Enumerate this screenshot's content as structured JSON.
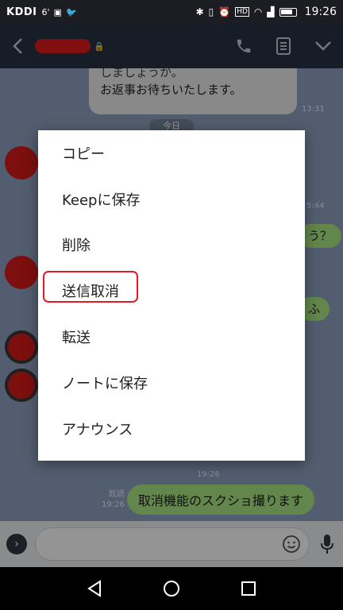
{
  "status_bar": {
    "carrier": "KDDI",
    "time": "19:26",
    "hd": "HD"
  },
  "header": {
    "back_icon": "chevron-left-icon",
    "icons": [
      "phone-icon",
      "notes-icon",
      "chevron-down-icon"
    ]
  },
  "chat": {
    "gray_bubble_lines": [
      "しましょうか。",
      "お返事お待ちいたします。"
    ],
    "gray_bubble_time": "13:31",
    "date_label": "今日",
    "times": [
      "5:44",
      "19:26",
      "19:26"
    ],
    "partial_texts": [
      "う？",
      "ふ"
    ],
    "my_message": "取消機能のスクショ撮ります",
    "read_label": "既読"
  },
  "context_menu": {
    "items": [
      "コピー",
      "Keepに保存",
      "削除",
      "送信取消",
      "転送",
      "ノートに保存",
      "アナウンス"
    ],
    "highlighted_index": 3
  },
  "input": {
    "expand_icon": "chevron-right-icon",
    "emoji_icon": "smiley-icon",
    "mic_icon": "mic-icon"
  },
  "nav": [
    "back-triangle-icon",
    "home-circle-icon",
    "recents-square-icon"
  ],
  "colors": {
    "header": "#293242",
    "chat_bg": "#8da1bf",
    "green_bubble": "#a9e783",
    "highlight": "#e11b24"
  }
}
